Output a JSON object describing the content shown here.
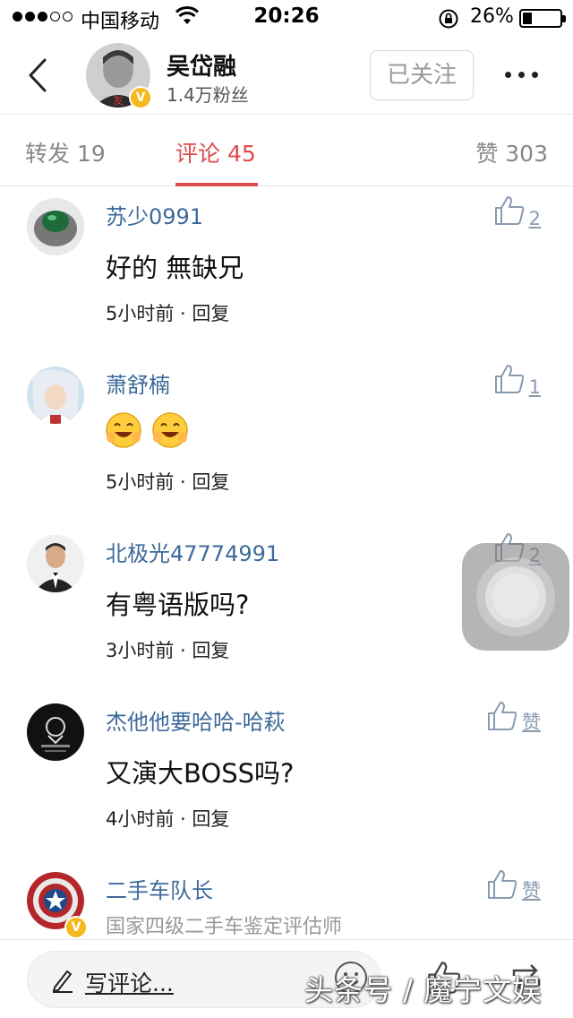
{
  "status_bar": {
    "carrier": "中国移动",
    "time": "20:26",
    "battery_percent": "26%",
    "battery_level": 0.26
  },
  "header": {
    "user_name": "吴岱融",
    "fans": "1.4万粉丝",
    "follow_label": "已关注",
    "verified_badge": "V"
  },
  "tabs": [
    {
      "label": "转发 19"
    },
    {
      "label": "评论 45"
    },
    {
      "label": "赞 303"
    }
  ],
  "comments": [
    {
      "name": "苏少0991",
      "text": "好的 無缺兄",
      "meta": "5小时前 · 回复",
      "likes": "2"
    },
    {
      "name": "萧舒楠",
      "text": "",
      "emojis": [
        "grin-emoji",
        "grin-emoji"
      ],
      "meta": "5小时前 · 回复",
      "likes": "1"
    },
    {
      "name": "北极光47774991",
      "text": "有粤语版吗?",
      "meta": "3小时前 · 回复",
      "likes": "2"
    },
    {
      "name": "杰他他要哈哈-哈萩",
      "text": "又演大BOSS吗?",
      "meta": "4小时前 · 回复",
      "likes": "赞"
    },
    {
      "name": "二手车队长",
      "subtitle": "国家四级二手车鉴定评估师",
      "likes": "赞",
      "verified_badge": "V"
    }
  ],
  "bottom_bar": {
    "write_label": "写评论..."
  },
  "watermark": "头条号 / 魔宁文娱",
  "colors": {
    "accent": "#e04a4a",
    "name_blue": "#3d6a9a",
    "badge": "#f5b91e"
  }
}
